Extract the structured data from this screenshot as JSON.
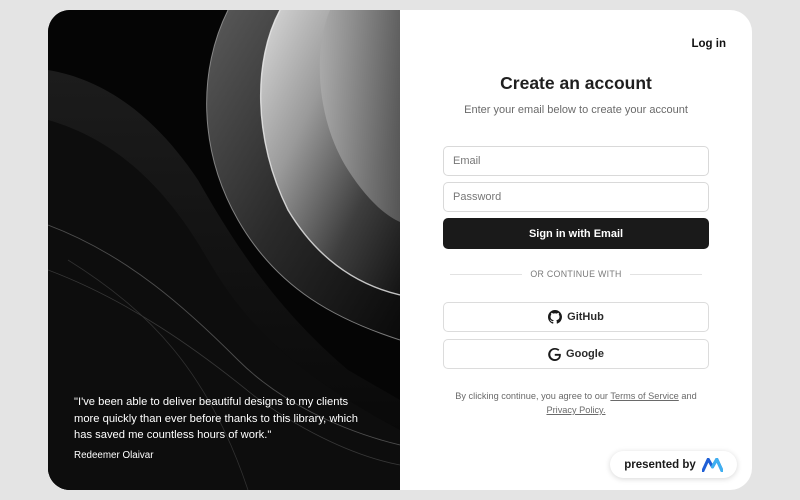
{
  "nav": {
    "login_label": "Log in"
  },
  "form": {
    "title": "Create an account",
    "subtitle": "Enter your email below to create your account",
    "email_placeholder": "Email",
    "password_placeholder": "Password",
    "submit_label": "Sign in with Email",
    "divider_label": "OR CONTINUE WITH",
    "github_label": "GitHub",
    "google_label": "Google"
  },
  "legal": {
    "prefix": "By clicking continue, you agree to our",
    "terms_label": "Terms of Service",
    "and": "and",
    "privacy_label": "Privacy Policy."
  },
  "testimonial": {
    "quote": "\"I've been able to deliver beautiful designs to my clients more quickly than ever before thanks to this library, which has saved me countless hours of work.\"",
    "author": "Redeemer Olaivar"
  },
  "badge": {
    "label": "presented by",
    "logo_icon": "brand-logo-icon"
  },
  "colors": {
    "page_bg": "#e4e4e4",
    "panel_dark": "#050505",
    "primary_button": "#1a1a1a",
    "brand_blue": "#1f5fd6"
  }
}
